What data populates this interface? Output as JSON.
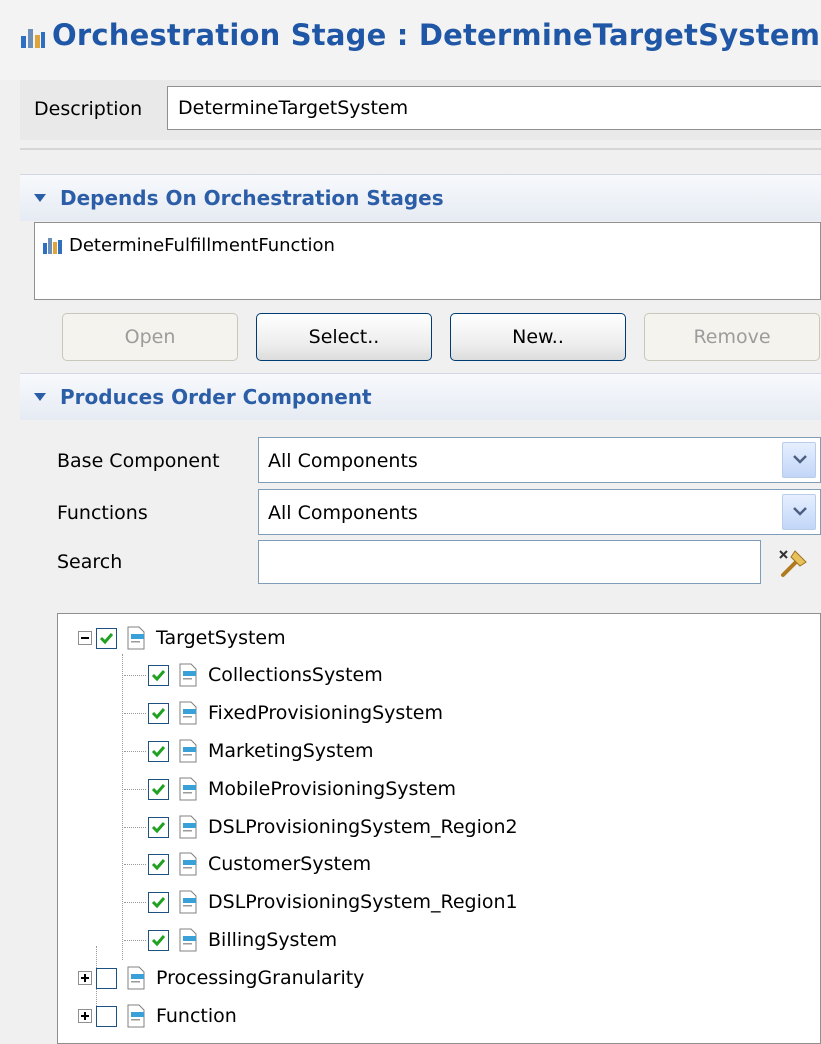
{
  "header": {
    "title": "Orchestration Stage : DetermineTargetSystem"
  },
  "description": {
    "label": "Description",
    "value": "DetermineTargetSystem"
  },
  "depends_section": {
    "title": "Depends On Orchestration Stages",
    "items": [
      {
        "label": "DetermineFulfillmentFunction"
      }
    ],
    "buttons": {
      "open": "Open",
      "select": "Select..",
      "new": "New..",
      "remove": "Remove"
    }
  },
  "produces_section": {
    "title": "Produces Order Component",
    "base_component": {
      "label": "Base Component",
      "value": "All Components"
    },
    "functions": {
      "label": "Functions",
      "value": "All Components"
    },
    "search": {
      "label": "Search",
      "value": ""
    },
    "tree": {
      "root": {
        "label": "TargetSystem",
        "checked": true,
        "expanded": true
      },
      "children": [
        {
          "label": "CollectionsSystem",
          "checked": true
        },
        {
          "label": "FixedProvisioningSystem",
          "checked": true
        },
        {
          "label": "MarketingSystem",
          "checked": true
        },
        {
          "label": "MobileProvisioningSystem",
          "checked": true
        },
        {
          "label": "DSLProvisioningSystem_Region2",
          "checked": true
        },
        {
          "label": "CustomerSystem",
          "checked": true
        },
        {
          "label": "DSLProvisioningSystem_Region1",
          "checked": true
        },
        {
          "label": "BillingSystem",
          "checked": true
        }
      ],
      "others": [
        {
          "label": "ProcessingGranularity",
          "checked": false,
          "expanded": false
        },
        {
          "label": "Function",
          "checked": false,
          "expanded": false
        }
      ]
    }
  },
  "colors": {
    "title": "#1f57a6",
    "section_title": "#2c5ea8",
    "check": "#21a121"
  },
  "icons": [
    "orchestration-stage-icon",
    "chevron-down-icon",
    "clear-search-icon",
    "order-component-icon",
    "checkmark-icon"
  ]
}
